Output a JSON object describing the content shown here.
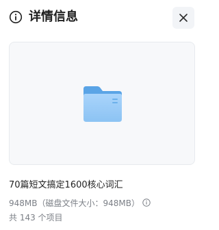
{
  "header": {
    "title": "详情信息",
    "info_icon": "info-circle-icon",
    "close_icon": "close-icon"
  },
  "preview": {
    "icon": "folder-icon",
    "background_color": "#f7f8fa",
    "folder_color": "#8ec5f5"
  },
  "details": {
    "file_name": "70篇短文搞定1600核心词汇",
    "size_text": "948MB（磁盘文件大小：948MB）",
    "size_help_icon": "info-circle-icon",
    "item_count_text": "共 143 个项目"
  }
}
